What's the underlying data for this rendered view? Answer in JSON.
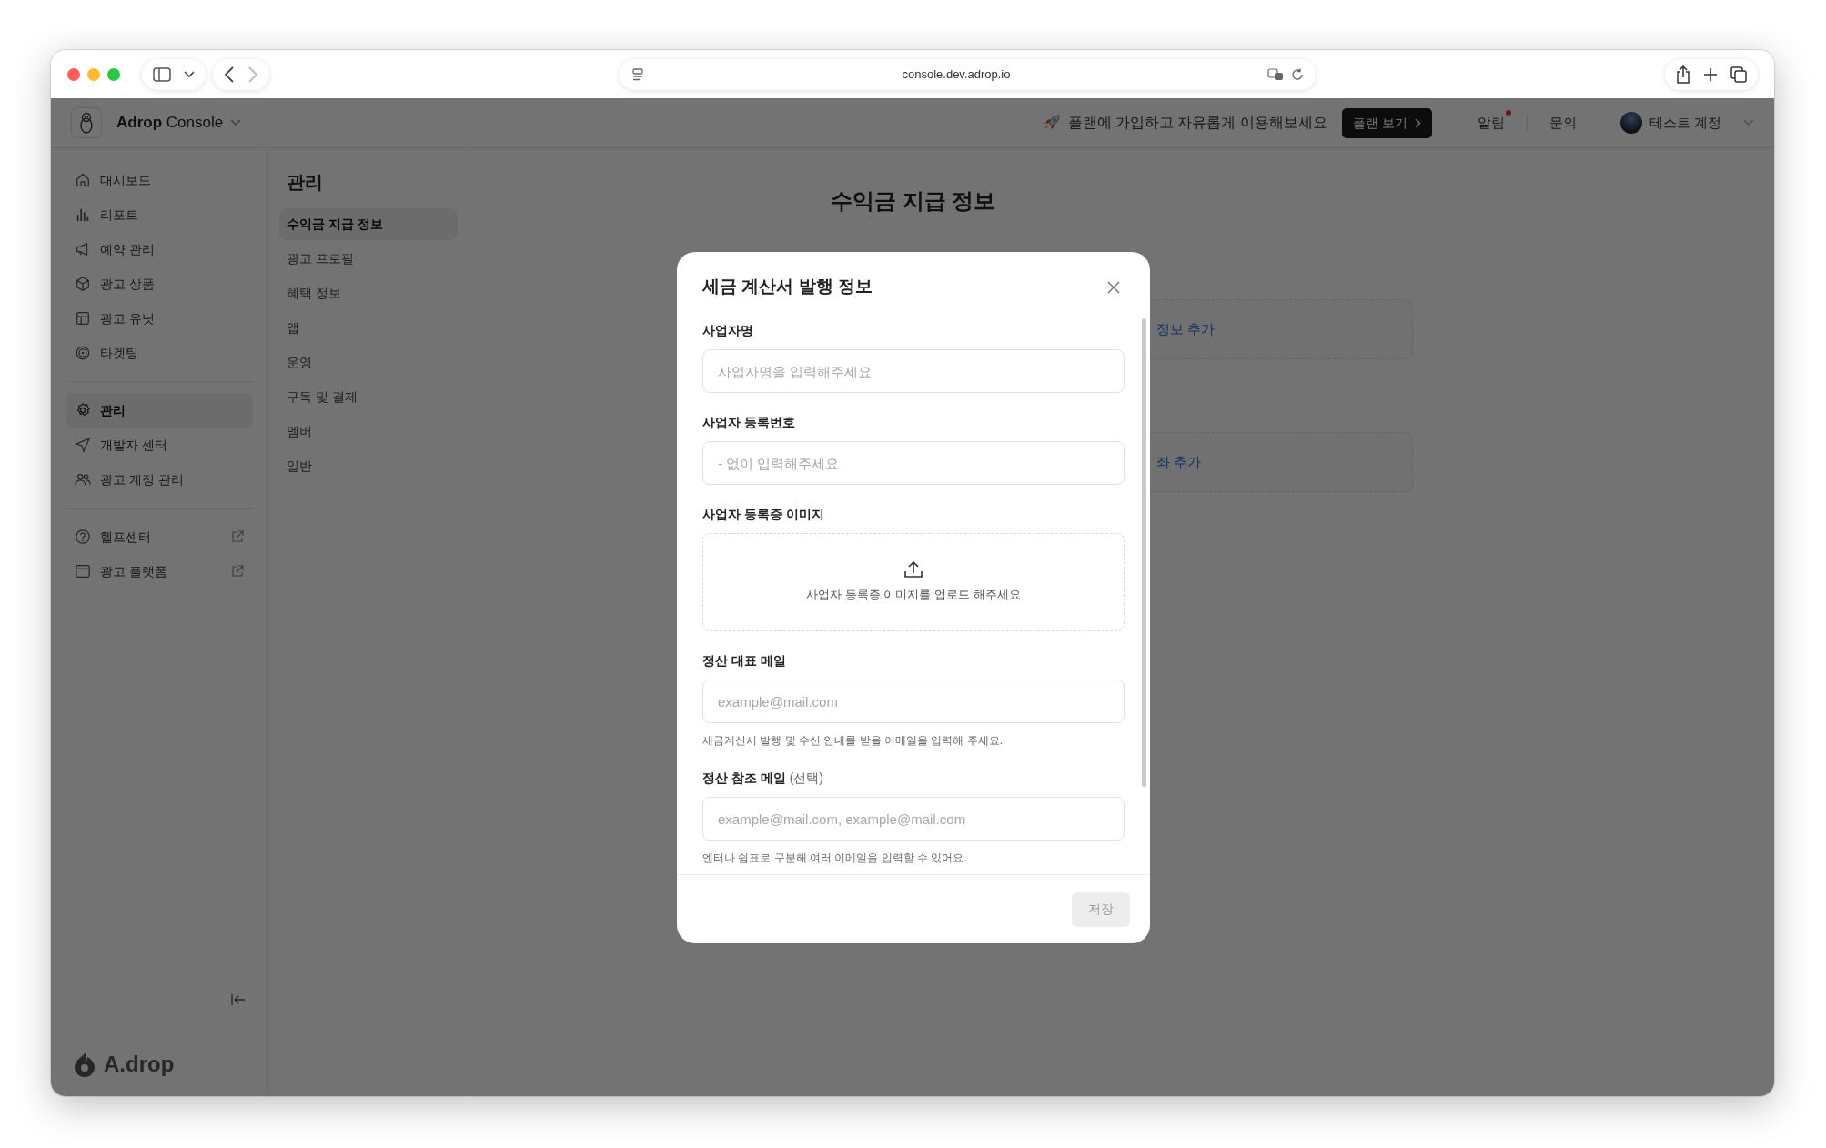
{
  "browser": {
    "url": "console.dev.adrop.io"
  },
  "header": {
    "app_name": "**Adrop** Console",
    "promo": "플랜에 가입하고 자유롭게 이용해보세요",
    "plan_button": "플랜 보기",
    "notifications": {
      "label": "알림",
      "unread": true
    },
    "inquiry": "문의",
    "account": "테스트 계정"
  },
  "sidebar": {
    "groups": [
      {
        "items": [
          {
            "label": "대시보드",
            "selected": false,
            "external": false
          },
          {
            "label": "리포트",
            "selected": false,
            "external": false
          },
          {
            "label": "예약 관리",
            "selected": false,
            "external": false
          },
          {
            "label": "광고 상품",
            "selected": false,
            "external": false
          },
          {
            "label": "광고 유닛",
            "selected": false,
            "external": false
          },
          {
            "label": "타겟팅",
            "selected": false,
            "external": false
          }
        ]
      },
      {
        "items": [
          {
            "label": "관리",
            "selected": true,
            "external": false
          },
          {
            "label": "개발자 센터",
            "selected": false,
            "external": false
          },
          {
            "label": "광고 계정 관리",
            "selected": false,
            "external": false
          }
        ]
      },
      {
        "items": [
          {
            "label": "헬프센터",
            "selected": false,
            "external": true
          },
          {
            "label": "광고 플랫폼",
            "selected": false,
            "external": true
          }
        ]
      }
    ],
    "footer_logo": "A.drop"
  },
  "submenu": {
    "title": "관리",
    "items": [
      {
        "label": "수익금 지급 정보",
        "selected": true
      },
      {
        "label": "광고 프로필",
        "selected": false
      },
      {
        "label": "혜택 정보",
        "selected": false
      },
      {
        "label": "앱",
        "selected": false
      },
      {
        "label": "운영",
        "selected": false
      },
      {
        "label": "구독 및 결제",
        "selected": false
      },
      {
        "label": "멤버",
        "selected": false
      },
      {
        "label": "일반",
        "selected": false
      }
    ]
  },
  "page": {
    "title": "수익금 지급 정보",
    "cards": [
      {
        "action": "정보 추가"
      },
      {
        "action": "좌 추가"
      }
    ]
  },
  "modal": {
    "title": "세금 계산서 발행 정보",
    "fields": [
      {
        "kind": "text",
        "label": "사업자명",
        "placeholder": "사업자명을 입력해주세요"
      },
      {
        "kind": "text",
        "label": "사업자 등록번호",
        "placeholder": "- 없이 입력해주세요"
      },
      {
        "kind": "upload",
        "label": "사업자 등록증 이미지",
        "prompt": "사업자 등록증 이미지를 업로드 해주세요"
      },
      {
        "kind": "text",
        "label": "정산 대표 메일",
        "placeholder": "example@mail.com",
        "hint": "세금계산서 발행 및 수신 안내를 받을 이메일을 입력해 주세요."
      },
      {
        "kind": "text",
        "label": "정산 참조 메일",
        "optional": "(선택)",
        "placeholder": "example@mail.com, example@mail.com",
        "hint": "엔터나 쉼표로 구분해 여러 이메일을 입력할 수 있어요."
      }
    ],
    "save_button": {
      "label": "저장",
      "disabled": true
    }
  }
}
